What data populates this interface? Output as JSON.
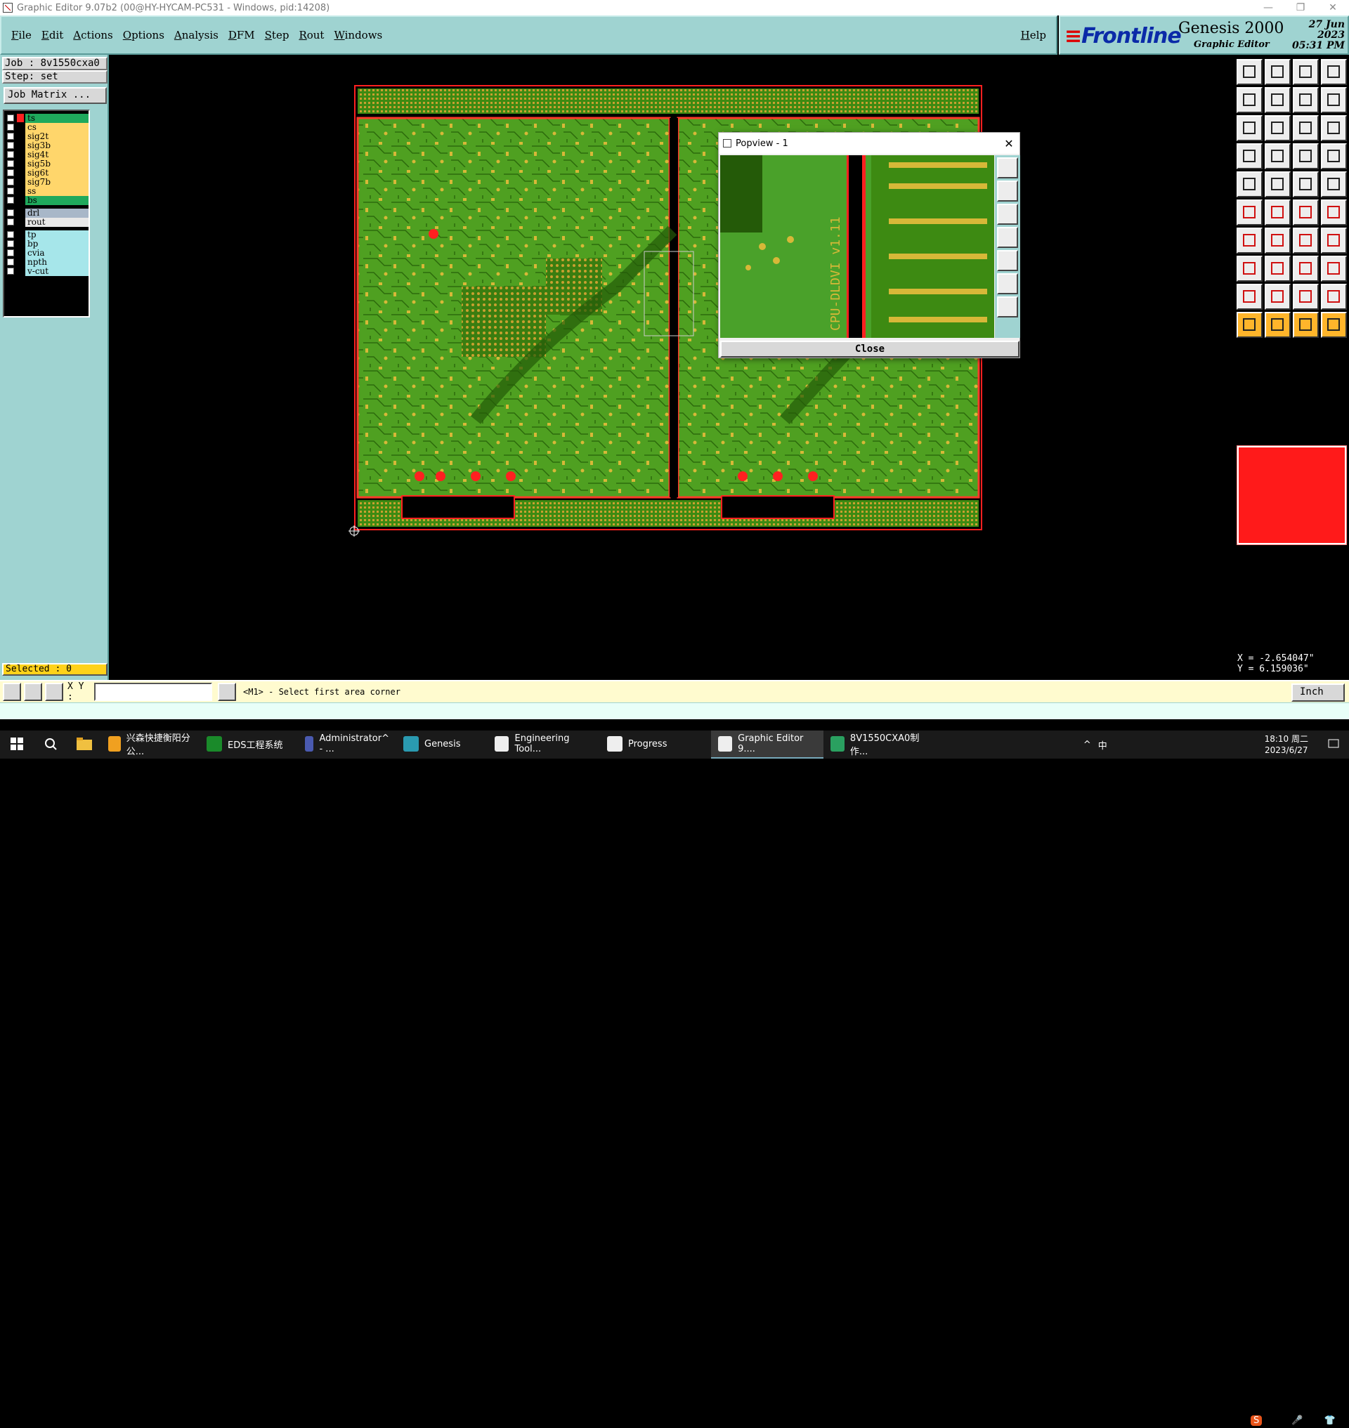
{
  "window": {
    "title": "Graphic Editor 9.07b2 (00@HY-HYCAM-PC531 - Windows, pid:14208)",
    "min": "—",
    "max": "❐",
    "close": "✕"
  },
  "menu": {
    "items": [
      "File",
      "Edit",
      "Actions",
      "Options",
      "Analysis",
      "DFM",
      "Step",
      "Rout",
      "Windows"
    ],
    "help": "Help"
  },
  "brand": {
    "logo": "Frontline",
    "product": "Genesis 2000",
    "subtitle": "Graphic Editor",
    "date": "27 Jun 2023",
    "time": "05:31 PM"
  },
  "job": {
    "job": "Job : 8v1550cxa0",
    "step": "Step: set",
    "job_matrix": "Job Matrix ..."
  },
  "layers": [
    {
      "name": "ts",
      "color": "#ff2020",
      "bg": "#1fa95c"
    },
    {
      "name": "cs",
      "color": "#000000",
      "bg": "#ffd66b"
    },
    {
      "name": "sig2t",
      "color": "#000000",
      "bg": "#ffd66b"
    },
    {
      "name": "sig3b",
      "color": "#000000",
      "bg": "#ffd66b"
    },
    {
      "name": "sig4t",
      "color": "#000000",
      "bg": "#ffd66b"
    },
    {
      "name": "sig5b",
      "color": "#000000",
      "bg": "#ffd66b"
    },
    {
      "name": "sig6t",
      "color": "#000000",
      "bg": "#ffd66b"
    },
    {
      "name": "sig7b",
      "color": "#000000",
      "bg": "#ffd66b"
    },
    {
      "name": "ss",
      "color": "#000000",
      "bg": "#ffd66b"
    },
    {
      "name": "bs",
      "color": "#000000",
      "bg": "#1fa95c"
    },
    {
      "name": "drl",
      "color": "#000000",
      "bg": "#a8b7c8"
    },
    {
      "name": "rout",
      "color": "#000000",
      "bg": "#e8e8e8"
    },
    {
      "name": "tp",
      "color": "#000000",
      "bg": "#a6e6ea"
    },
    {
      "name": "bp",
      "color": "#000000",
      "bg": "#a6e6ea"
    },
    {
      "name": "cvia",
      "color": "#000000",
      "bg": "#a6e6ea"
    },
    {
      "name": "npth",
      "color": "#000000",
      "bg": "#a6e6ea"
    },
    {
      "name": "v-cut",
      "color": "#000000",
      "bg": "#a6e6ea"
    }
  ],
  "selected": "Selected : 0",
  "popview": {
    "title": "Popview - 1",
    "close_label": "Close",
    "close_x": "✕",
    "board_text": "CPU-DLDVI v1.11"
  },
  "coords": {
    "x": "X = -2.654047\"",
    "y": "Y = 6.159036\""
  },
  "command": {
    "xy_label": "X Y :",
    "input_value": "",
    "message": "<M1> - Select first area corner",
    "unit": "Inch"
  },
  "ime": [
    "中",
    "°,",
    "🎤",
    "⌨",
    "👕",
    "⊞"
  ],
  "taskbar": {
    "items": [
      {
        "label": "兴森快捷衡阳分公...",
        "color": "#f0a020"
      },
      {
        "label": "EDS工程系统",
        "color": "#1a8a2a"
      },
      {
        "label": "Administrator^ - ...",
        "color": "#4a5ab0"
      },
      {
        "label": "Genesis",
        "color": "#2a9ab0"
      },
      {
        "label": "Engineering Tool...",
        "color": "#eeeeee"
      },
      {
        "label": "Progress",
        "color": "#eeeeee"
      },
      {
        "label": "Graphic Editor 9....",
        "color": "#eeeeee"
      },
      {
        "label": "8V1550CXA0制作...",
        "color": "#2aa060"
      }
    ],
    "time": "18:10 周二",
    "date": "2023/6/27",
    "tray_lang": "中"
  }
}
